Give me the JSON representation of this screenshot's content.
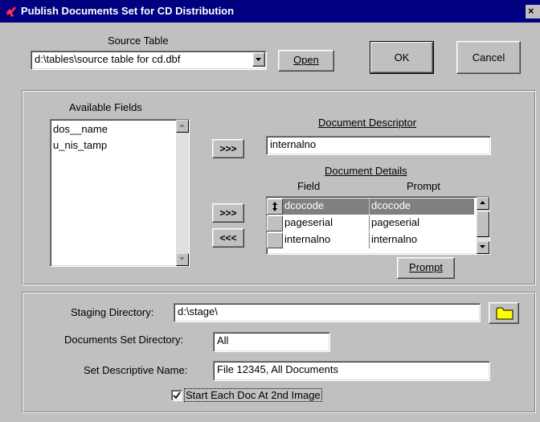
{
  "window": {
    "title": "Publish Documents Set for CD Distribution",
    "close_label": "×"
  },
  "source": {
    "label": "Source Table",
    "value": "d:\\tables\\source table for cd.dbf",
    "open_label": "Open",
    "ok_label": "OK",
    "cancel_label": "Cancel"
  },
  "fields": {
    "available_label": "Available Fields",
    "available_items": [
      "dos__name",
      "u_nis_tamp"
    ],
    "add_descriptor_label": ">>>",
    "add_detail_label": ">>>",
    "remove_detail_label": "<<<",
    "descriptor_label": "Document Descriptor",
    "descriptor_value": "internalno",
    "details_label": "Document Details",
    "col_field": "Field",
    "col_prompt": "Prompt",
    "details_rows": [
      {
        "field": "dcocode",
        "prompt": "dcocode",
        "selected": true
      },
      {
        "field": "pageserial",
        "prompt": "pageserial",
        "selected": false
      },
      {
        "field": "internalno",
        "prompt": "internalno",
        "selected": false
      }
    ],
    "prompt_button_label": "Prompt"
  },
  "output": {
    "staging_label": "Staging Directory:",
    "staging_value": "d:\\stage\\",
    "docset_label": "Documents Set Directory:",
    "docset_value": "All",
    "descname_label": "Set Descriptive Name:",
    "descname_value": "File 12345, All Documents",
    "start_checkbox_label": "Start Each Doc At 2nd Image",
    "start_checkbox_checked": true
  },
  "colors": {
    "titlebar": "#000080",
    "selection": "#808080",
    "folder": "#ffff00"
  }
}
